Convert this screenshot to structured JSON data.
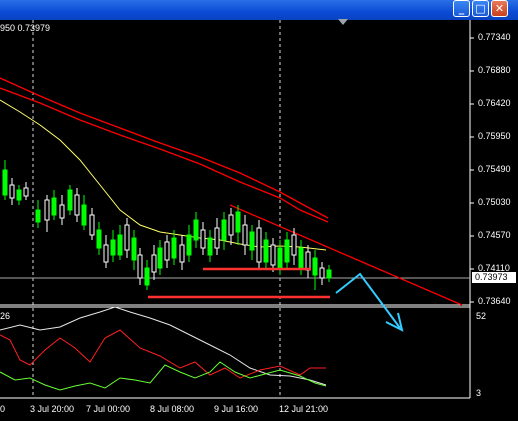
{
  "window": {
    "minimize": "_",
    "maximize": "□",
    "close": "✕",
    "buttons_colors": {
      "title": "#0b4bd6",
      "close": "#c8401c"
    }
  },
  "chart": {
    "header": "950 0.73979",
    "price_labels": [
      "0.77340",
      "0.76880",
      "0.76420",
      "0.75950",
      "0.75490",
      "0.75030",
      "0.74570",
      "0.74110",
      "0.73640"
    ],
    "current_price": "0.73973",
    "time_labels": [
      "0",
      "3 Jul 20:00",
      "7 Jul 00:00",
      "8 Jul 08:00",
      "9 Jul 16:00",
      "12 Jul 21:00"
    ],
    "indicator_label": "26",
    "indicator_levels": [
      "52",
      "3"
    ],
    "colors": {
      "bull": "#00ff00",
      "bear": "#ffffff",
      "ma_slow": "#ff0000",
      "ma_fast": "#ffff66",
      "support": "#ff3030",
      "forecast_arrow": "#33ccff",
      "ind_white": "#e8e8e8",
      "ind_red": "#ff2020",
      "ind_green": "#66ff33"
    }
  }
}
